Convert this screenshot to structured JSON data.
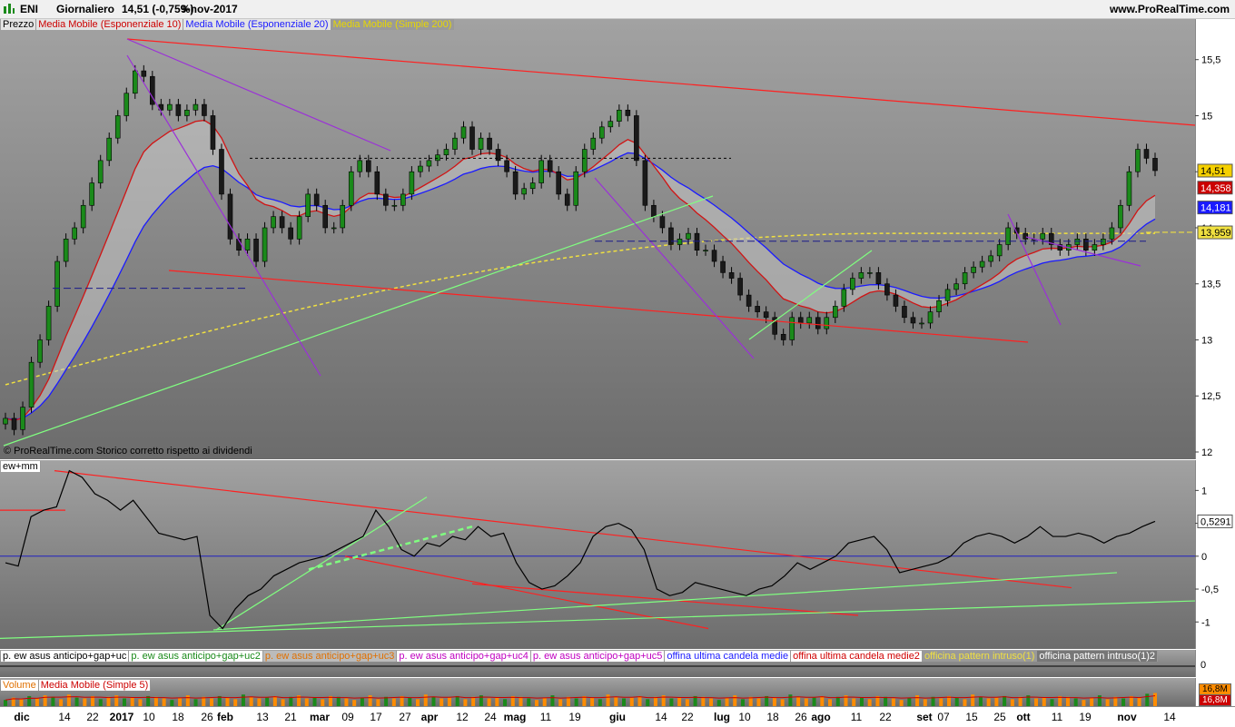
{
  "header": {
    "symbol": "ENI",
    "period": "Giornaliero",
    "price": "14,51 (-0,75%)",
    "date": "9-nov-2017",
    "site": "www.ProRealTime.com"
  },
  "price_legend": [
    "Prezzo",
    "Media Mobile (Esponenziale 10)",
    "Media Mobile (Esponenziale 20)",
    "Media Mobile (Simple 200)"
  ],
  "copyright": "© ProRealTime.com  Storico corretto rispetto ai dividendi",
  "ind_title": "ew+mm",
  "strip_legend": [
    "p. ew asus anticipo+gap+uc",
    "p. ew asus anticipo+gap+uc2",
    "p. ew asus anticipo+gap+uc3",
    "p. ew asus anticipo+gap+uc4",
    "p. ew asus anticipo+gap+uc5",
    "offina ultima candela medie",
    "offina ultima candela medie2",
    "officina pattern intruso(1)",
    "officina pattern intruso(1)2"
  ],
  "vol_legend": [
    "Volume",
    "Media Mobile (Simple 5)"
  ],
  "strip_axis": "0",
  "colors": {
    "ema10": "#d01414",
    "ema20": "#1a1aff",
    "sma200": "#f0e040",
    "up": "#1a8a1a",
    "down": "#1a1a1a",
    "trend_red": "#ff2020",
    "trend_green": "#80ff80",
    "trend_purple": "#9b30d8",
    "volume": "#ff8c00"
  },
  "chart_data": [
    {
      "type": "candlestick",
      "title": "ENI",
      "ylim": [
        12.0,
        15.7
      ],
      "y_ticks": [
        "15,5",
        "15",
        "14,5",
        "14",
        "13,5",
        "13",
        "12,5",
        "12"
      ],
      "last_labels": {
        "price": "14,51",
        "ema10": "14,358",
        "ema20": "14,181",
        "sma200": "13,959"
      },
      "x_ticks": [
        "dic",
        "14",
        "22",
        "2017",
        "10",
        "18",
        "26",
        "feb",
        "13",
        "21",
        "mar",
        "09",
        "17",
        "27",
        "apr",
        "12",
        "24",
        "mag",
        "11",
        "19",
        "giu",
        "14",
        "22",
        "lug",
        "10",
        "18",
        "26",
        "ago",
        "11",
        "22",
        "set",
        "07",
        "15",
        "25",
        "ott",
        "11",
        "19",
        "nov",
        "14"
      ],
      "close_series": [
        12.3,
        12.2,
        12.4,
        12.8,
        13.0,
        13.3,
        13.7,
        13.9,
        14.0,
        14.2,
        14.4,
        14.6,
        14.8,
        15.0,
        15.2,
        15.4,
        15.35,
        15.1,
        15.05,
        15.1,
        15.0,
        15.05,
        15.1,
        15.0,
        14.7,
        14.3,
        13.9,
        13.8,
        13.9,
        13.7,
        14.0,
        14.1,
        14.0,
        13.9,
        14.1,
        14.3,
        14.2,
        14.0,
        14.0,
        14.2,
        14.5,
        14.6,
        14.5,
        14.3,
        14.2,
        14.2,
        14.3,
        14.5,
        14.55,
        14.6,
        14.65,
        14.7,
        14.8,
        14.9,
        14.7,
        14.8,
        14.7,
        14.6,
        14.5,
        14.3,
        14.35,
        14.4,
        14.6,
        14.5,
        14.3,
        14.2,
        14.5,
        14.7,
        14.8,
        14.9,
        14.95,
        15.05,
        15.0,
        14.6,
        14.2,
        14.1,
        14.0,
        13.85,
        13.9,
        13.95,
        13.8,
        13.8,
        13.7,
        13.6,
        13.55,
        13.4,
        13.3,
        13.25,
        13.2,
        13.05,
        13.0,
        13.2,
        13.15,
        13.2,
        13.1,
        13.2,
        13.3,
        13.45,
        13.55,
        13.6,
        13.6,
        13.5,
        13.4,
        13.3,
        13.2,
        13.15,
        13.15,
        13.25,
        13.35,
        13.45,
        13.5,
        13.6,
        13.65,
        13.7,
        13.75,
        13.85,
        14.0,
        13.95,
        13.9,
        13.9,
        13.95,
        13.85,
        13.8,
        13.85,
        13.9,
        13.8,
        13.85,
        13.9,
        14.0,
        14.2,
        14.5,
        14.7,
        14.62,
        14.51
      ],
      "annotations": [
        {
          "type": "hline",
          "value": 13.46
        },
        {
          "type": "hline",
          "value": 14.62
        },
        {
          "type": "hline",
          "value": 13.88
        }
      ]
    },
    {
      "type": "line",
      "title": "ew+mm",
      "ylim": [
        -1.3,
        1.35
      ],
      "y_ticks": [
        "1",
        "0,5",
        "0",
        "-0,5",
        "-1"
      ],
      "last_label": "0,5291",
      "values": [
        -0.1,
        -0.15,
        0.6,
        0.7,
        0.75,
        1.3,
        1.2,
        0.95,
        0.85,
        0.7,
        0.85,
        0.6,
        0.35,
        0.3,
        0.25,
        0.3,
        -0.9,
        -1.1,
        -0.8,
        -0.6,
        -0.5,
        -0.3,
        -0.2,
        -0.1,
        -0.05,
        0.0,
        0.1,
        0.2,
        0.3,
        0.7,
        0.45,
        0.1,
        0.0,
        0.2,
        0.15,
        0.3,
        0.25,
        0.45,
        0.3,
        0.35,
        -0.1,
        -0.4,
        -0.5,
        -0.45,
        -0.3,
        -0.1,
        0.3,
        0.45,
        0.5,
        0.4,
        0.1,
        -0.5,
        -0.6,
        -0.55,
        -0.4,
        -0.45,
        -0.5,
        -0.55,
        -0.6,
        -0.5,
        -0.45,
        -0.3,
        -0.1,
        -0.2,
        -0.1,
        0.0,
        0.2,
        0.25,
        0.3,
        0.1,
        -0.25,
        -0.2,
        -0.15,
        -0.1,
        0.0,
        0.2,
        0.3,
        0.35,
        0.3,
        0.2,
        0.3,
        0.45,
        0.3,
        0.3,
        0.35,
        0.3,
        0.2,
        0.3,
        0.35,
        0.45,
        0.53
      ]
    },
    {
      "type": "bar",
      "title": "Volume",
      "ylim": [
        0,
        20
      ],
      "last_labels": {
        "volume": "16,8M",
        "sma5": "16,8M"
      },
      "values": [
        8,
        11,
        9,
        13,
        10,
        14,
        12,
        9,
        15,
        11,
        10,
        13,
        9,
        12,
        14,
        10,
        11,
        9,
        13,
        12,
        10,
        8,
        11,
        14,
        9,
        12,
        10,
        13,
        11,
        9,
        15,
        12,
        10,
        11,
        13,
        9,
        12,
        14,
        10,
        11,
        9,
        13,
        12,
        10,
        8,
        11,
        14,
        9,
        12,
        10,
        13,
        11,
        9,
        15,
        12,
        10,
        11,
        13,
        9,
        12,
        14,
        10,
        11,
        9,
        13,
        12,
        10,
        8,
        11,
        14,
        9,
        12,
        10,
        13,
        11,
        9,
        15,
        12,
        10,
        11,
        13,
        9,
        12,
        14,
        10,
        11,
        9,
        13,
        12,
        10,
        8,
        11,
        14,
        9,
        12,
        10,
        13,
        11,
        9,
        15,
        12,
        10,
        11,
        13,
        9,
        12,
        14,
        10,
        11,
        9,
        13,
        12,
        10,
        8,
        11,
        14,
        9,
        12,
        10,
        13,
        11,
        9,
        15,
        12,
        10,
        11,
        13,
        9,
        12,
        14,
        10,
        11,
        9,
        13,
        12,
        10,
        8,
        11,
        14,
        9,
        12,
        10,
        13,
        11,
        16,
        17
      ]
    }
  ]
}
